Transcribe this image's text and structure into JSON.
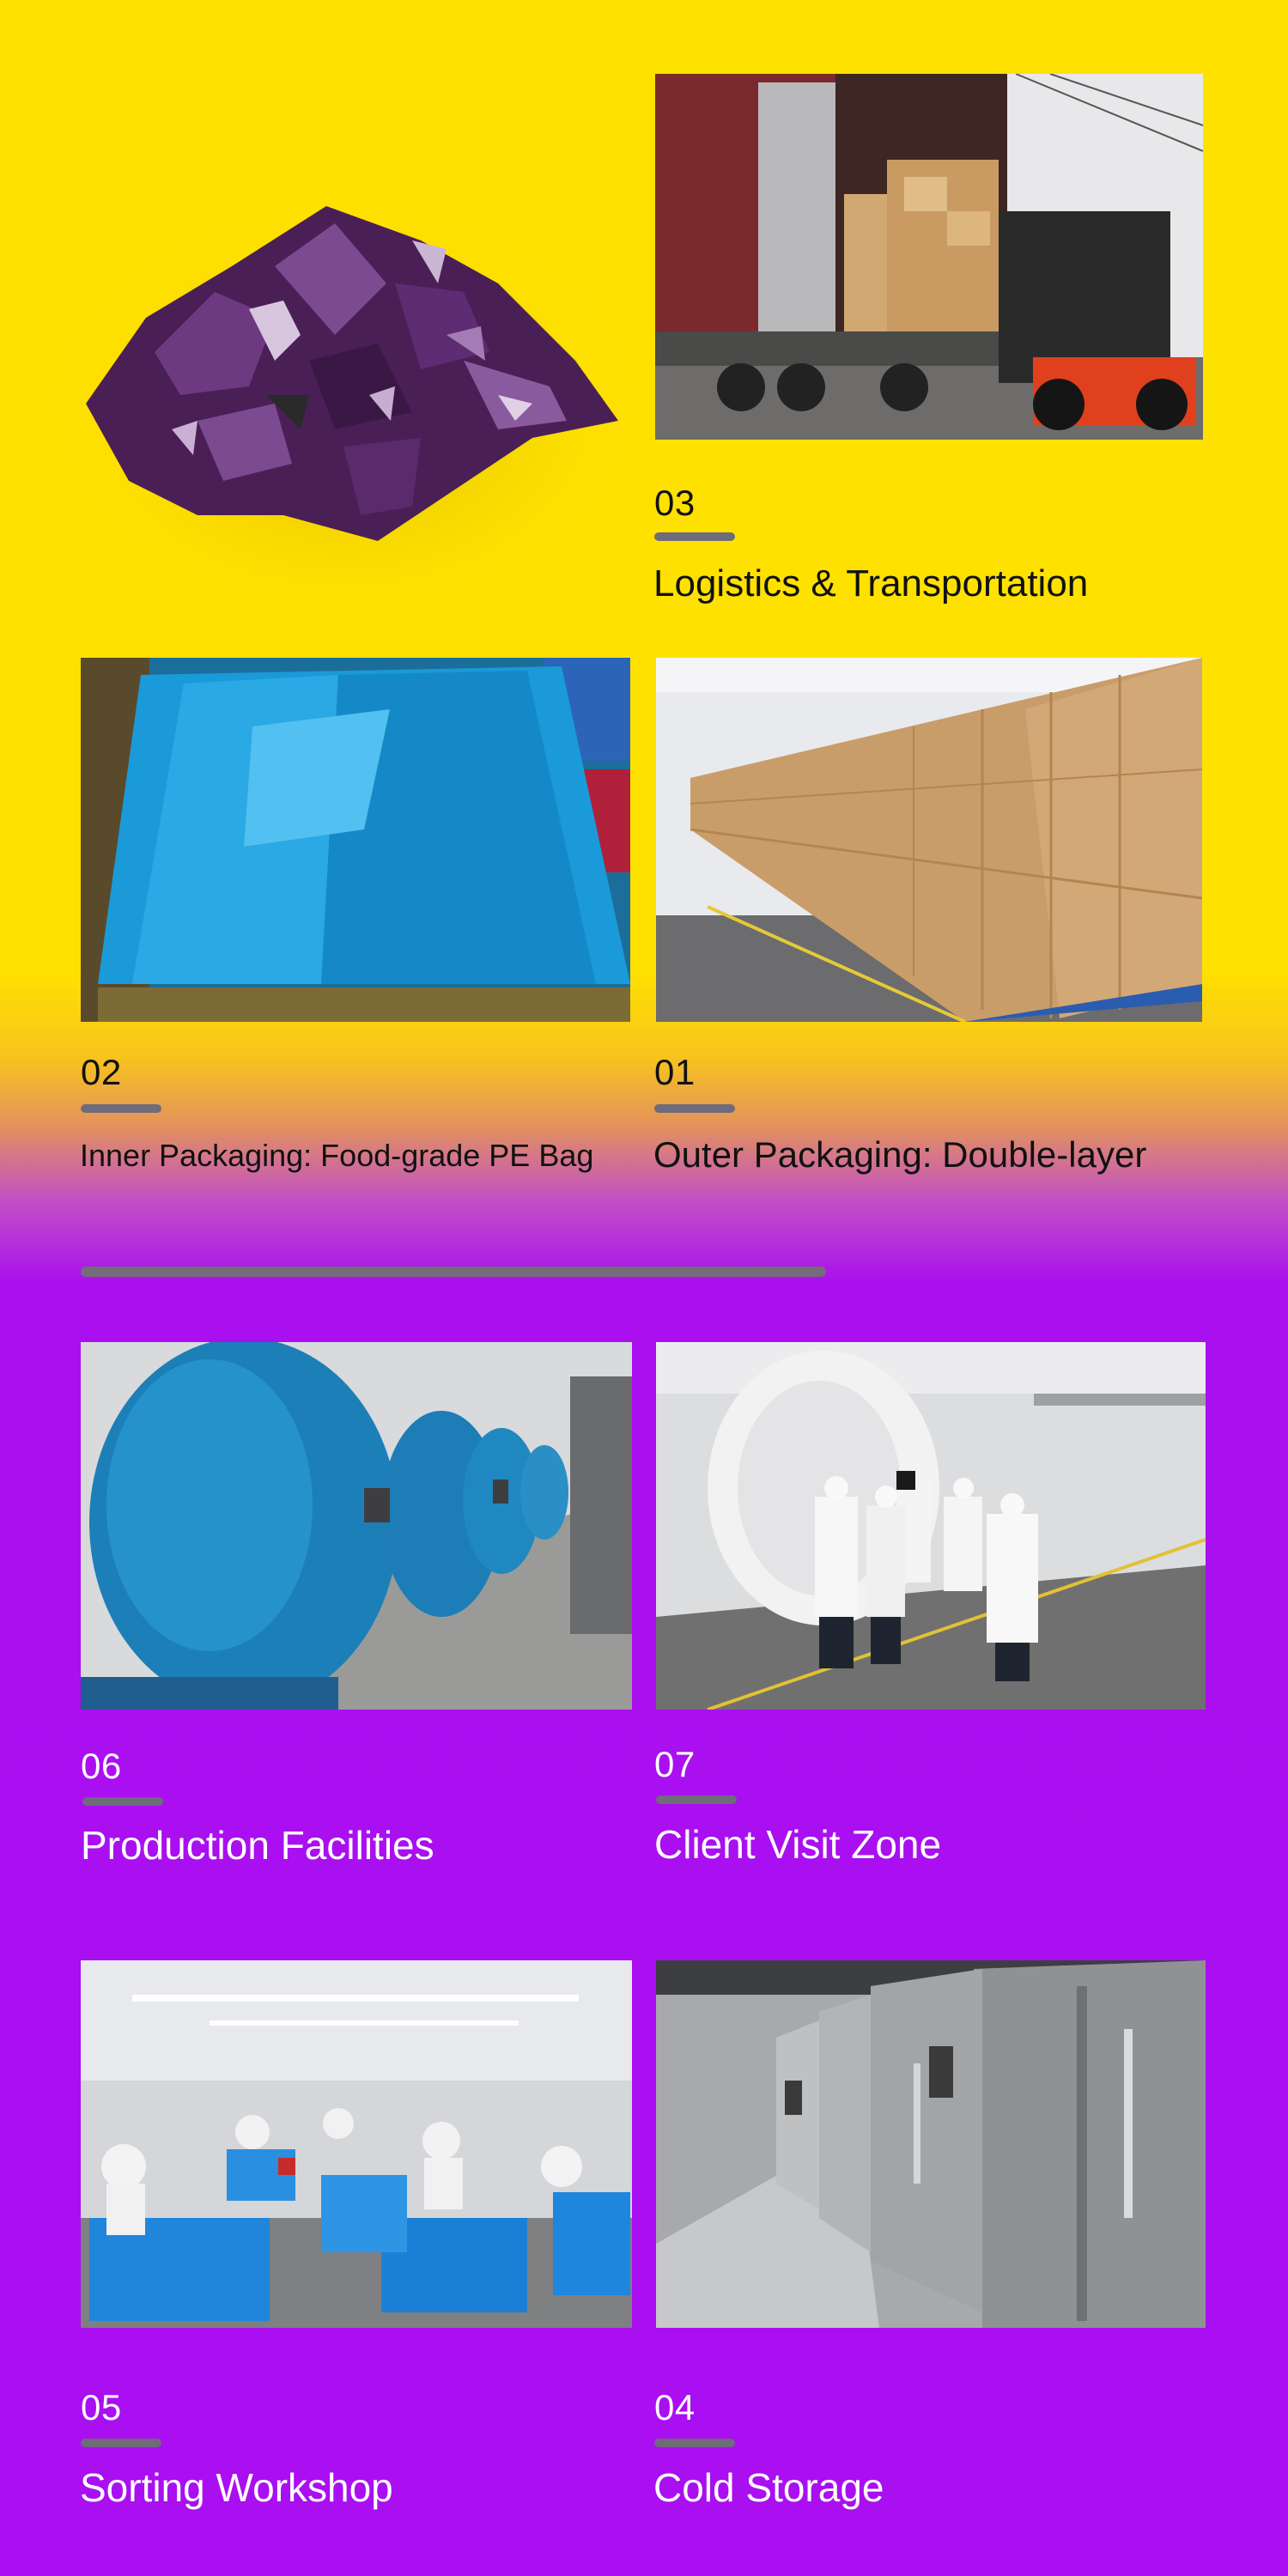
{
  "sections": {
    "logistics": {
      "number": "03",
      "title": "Logistics & Transportation"
    },
    "inner_packaging": {
      "number": "02",
      "title": "Inner Packaging: Food-grade PE Bag"
    },
    "outer_packaging": {
      "number": "01",
      "title": "Outer Packaging: Double-layer"
    },
    "production": {
      "number": "06",
      "title": "Production Facilities"
    },
    "client_visit": {
      "number": "07",
      "title": "Client Visit Zone"
    },
    "sorting": {
      "number": "05",
      "title": "Sorting Workshop"
    },
    "cold_storage": {
      "number": "04",
      "title": "Cold Storage"
    }
  },
  "colors": {
    "top_background": "#ffe100",
    "bottom_background": "#a90ff0",
    "accent_bar": "#6f6b7a"
  }
}
